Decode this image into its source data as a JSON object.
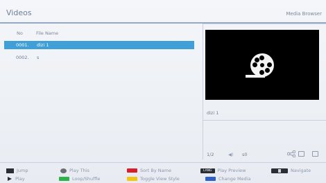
{
  "header": {
    "title": "Videos",
    "app_name": "Media Browser"
  },
  "file_list": {
    "columns": {
      "no": "No",
      "name": "File Name"
    },
    "rows": [
      {
        "no": "0001.",
        "name": "dizi 1",
        "selected": true
      },
      {
        "no": "0002.",
        "name": "s",
        "selected": false
      }
    ]
  },
  "preview": {
    "label": "dizi 1"
  },
  "status": {
    "page": "1/2",
    "volume": "s0"
  },
  "footer": {
    "jump": "Jump",
    "play_this": "Play This",
    "sort_by_name": "Sort By Name",
    "play_preview": "Play Preview",
    "navigate": "Navigate",
    "play": "Play",
    "loop_shuffle": "Loop/Shuffle",
    "toggle_view_style": "Toggle View Style",
    "change_media": "Change Media",
    "lang_key": "LANG",
    "colors": {
      "red": "#d81e28",
      "green": "#2db34a",
      "yellow": "#f3c514",
      "blue": "#2f5fc8"
    }
  }
}
